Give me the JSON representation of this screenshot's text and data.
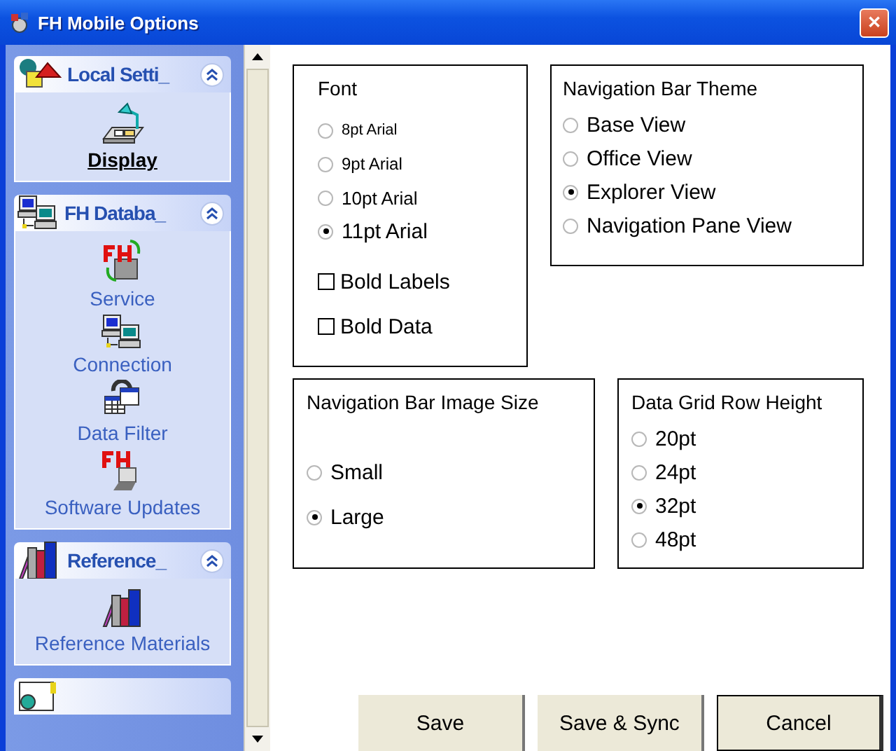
{
  "window": {
    "title": "FH Mobile Options",
    "close": "✕"
  },
  "sidebar": {
    "groups": [
      {
        "title": "Local Setti_",
        "expanded": true,
        "items": [
          {
            "label": "Display",
            "selected": true
          }
        ]
      },
      {
        "title": "FH Databa_",
        "expanded": true,
        "items": [
          {
            "label": "Service",
            "selected": false
          },
          {
            "label": "Connection",
            "selected": false
          },
          {
            "label": "Data Filter",
            "selected": false
          },
          {
            "label": "Software Updates",
            "selected": false
          }
        ]
      },
      {
        "title": "Reference_",
        "expanded": true,
        "items": [
          {
            "label": "Reference Materials",
            "selected": false
          }
        ]
      }
    ]
  },
  "font": {
    "title": "Font",
    "options": [
      {
        "label": "8pt Arial",
        "selected": false
      },
      {
        "label": "9pt Arial",
        "selected": false
      },
      {
        "label": "10pt Arial",
        "selected": false
      },
      {
        "label": "11pt Arial",
        "selected": true
      }
    ],
    "checks": [
      {
        "label": "Bold Labels",
        "checked": false
      },
      {
        "label": "Bold Data",
        "checked": false
      }
    ]
  },
  "navigation_bar_theme": {
    "title": "Navigation Bar Theme",
    "options": [
      {
        "label": "Base View",
        "selected": false
      },
      {
        "label": "Office View",
        "selected": false
      },
      {
        "label": "Explorer View",
        "selected": true
      },
      {
        "label": "Navigation Pane View",
        "selected": false
      }
    ]
  },
  "navigation_bar_image_size": {
    "title": "Navigation Bar Image Size",
    "options": [
      {
        "label": "Small",
        "selected": false
      },
      {
        "label": "Large",
        "selected": true
      }
    ]
  },
  "data_grid_row_height": {
    "title": "Data Grid Row Height",
    "options": [
      {
        "label": "20pt",
        "selected": false
      },
      {
        "label": "24pt",
        "selected": false
      },
      {
        "label": "32pt",
        "selected": true
      },
      {
        "label": "48pt",
        "selected": false
      }
    ]
  },
  "buttons": [
    {
      "label": "Save",
      "default": false
    },
    {
      "label": "Save & Sync",
      "default": false
    },
    {
      "label": "Cancel",
      "default": true
    }
  ]
}
